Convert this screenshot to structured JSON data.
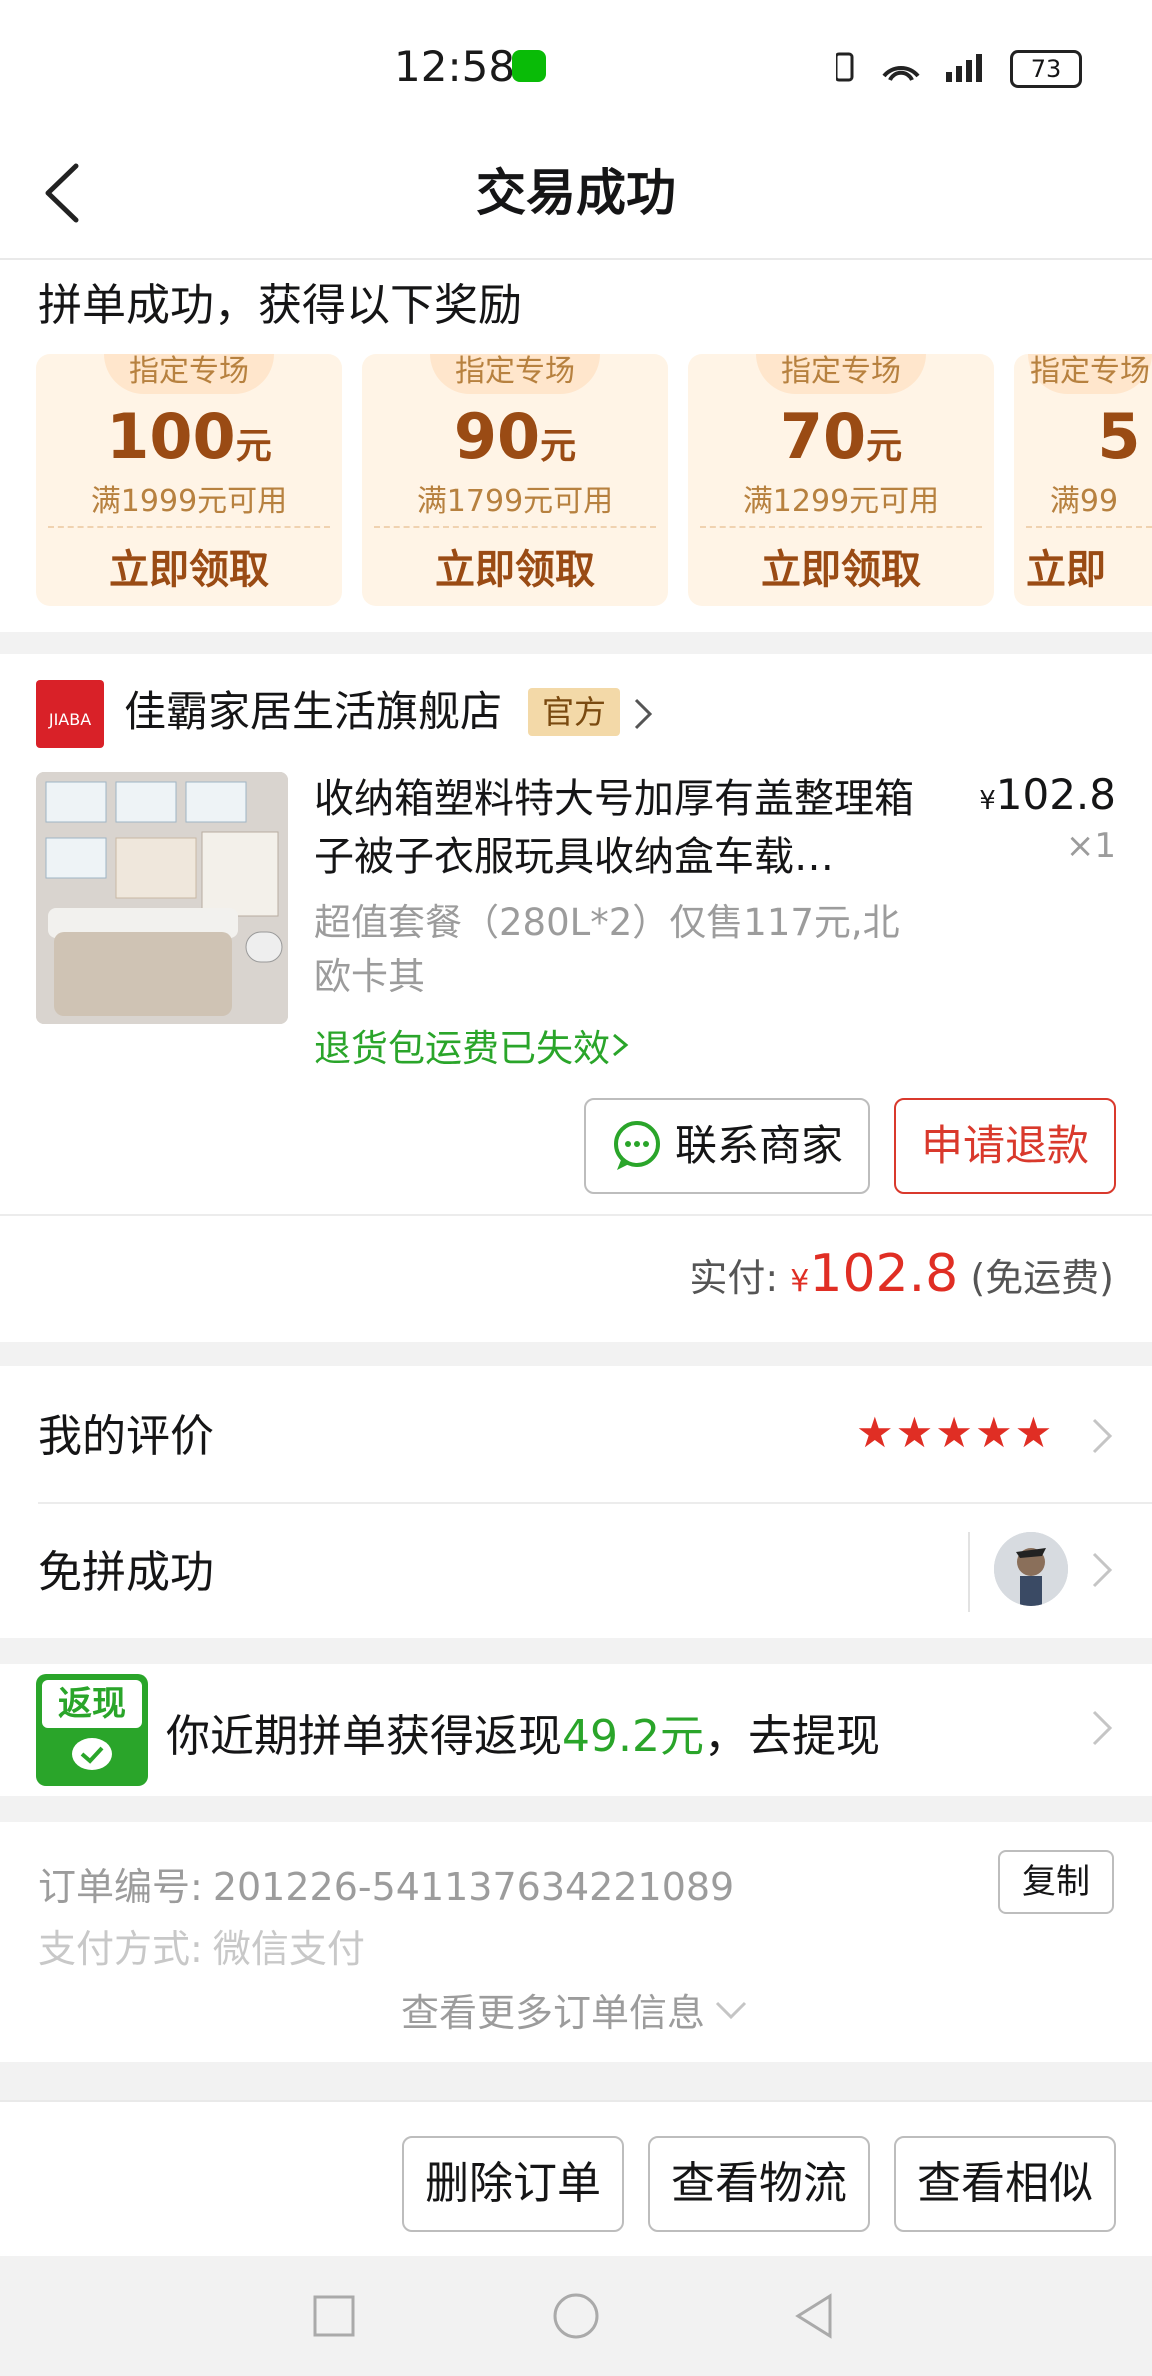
{
  "status_bar": {
    "time": "12:58",
    "battery": "73"
  },
  "header": {
    "title": "交易成功"
  },
  "coupons": {
    "heading": "拼单成功，获得以下奖励",
    "items": [
      {
        "tag": "指定专场",
        "amount": "100",
        "unit": "元",
        "condition": "满1999元可用",
        "action": "立即领取"
      },
      {
        "tag": "指定专场",
        "amount": "90",
        "unit": "元",
        "condition": "满1799元可用",
        "action": "立即领取"
      },
      {
        "tag": "指定专场",
        "amount": "70",
        "unit": "元",
        "condition": "满1299元可用",
        "action": "立即领取"
      },
      {
        "tag": "指定专场",
        "amount": "5",
        "unit": "",
        "condition": "满99",
        "action": "立即"
      }
    ]
  },
  "store": {
    "name": "佳霸家居生活旗舰店",
    "badge": "官方",
    "logo_text": "JIABA"
  },
  "product": {
    "title": "收纳箱塑料特大号加厚有盖整理箱子被子衣服玩具收纳盒车载…",
    "price_currency": "¥",
    "price": "102.8",
    "quantity": "×1",
    "spec": "超值套餐（280L*2）仅售117元,北欧卡其",
    "return_note": "退货包运费已失效",
    "contact_label": "联系商家",
    "refund_label": "申请退款"
  },
  "payment": {
    "label": "实付:",
    "currency": "¥",
    "amount": "102.8",
    "note": "(免运费)"
  },
  "review": {
    "label": "我的评价",
    "stars": "★★★★★",
    "rating": 5
  },
  "free_group": {
    "label": "免拼成功"
  },
  "cashback": {
    "badge": "返现",
    "text_prefix": "你近期拼单获得返现",
    "amount": "49.2元",
    "text_suffix": "，去提现"
  },
  "order": {
    "number_label": "订单编号:",
    "number": "201226-541137634221089",
    "pay_label": "支付方式:",
    "pay_method": "微信支付",
    "copy_label": "复制",
    "more_label": "查看更多订单信息"
  },
  "actions": {
    "delete": "删除订单",
    "logistics": "查看物流",
    "similar": "查看相似"
  },
  "colors": {
    "accent_red": "#e02e24",
    "green": "#2aa52a",
    "coupon_brown": "#9a4b14",
    "coupon_bg": "#fff4e6"
  }
}
